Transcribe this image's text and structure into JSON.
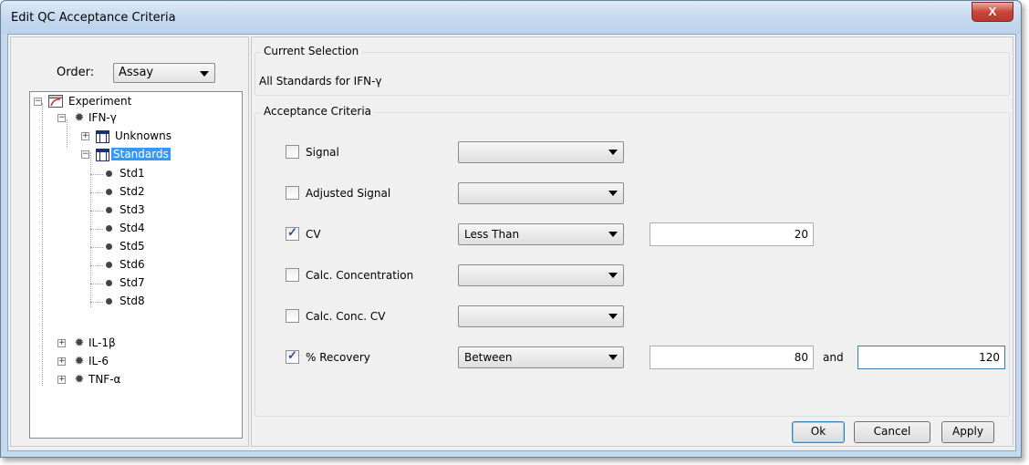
{
  "window": {
    "title": "Edit QC Acceptance Criteria",
    "close_glyph": "X"
  },
  "order": {
    "label": "Order:",
    "value": "Assay"
  },
  "tree": {
    "root": "Experiment",
    "assay1": "IFN-γ",
    "unknowns": "Unknowns",
    "standards": "Standards",
    "stds": [
      "Std1",
      "Std2",
      "Std3",
      "Std4",
      "Std5",
      "Std6",
      "Std7",
      "Std8"
    ],
    "assay2": "IL-1β",
    "assay3": "IL-6",
    "assay4": "TNF-α"
  },
  "current_selection": {
    "group_label": "Current Selection",
    "text": "All Standards for IFN-γ"
  },
  "acceptance": {
    "group_label": "Acceptance Criteria",
    "rows": [
      {
        "label": "Signal",
        "checked": false,
        "operator": "",
        "value1": "",
        "and_label": "",
        "value2": ""
      },
      {
        "label": "Adjusted Signal",
        "checked": false,
        "operator": "",
        "value1": "",
        "and_label": "",
        "value2": ""
      },
      {
        "label": "CV",
        "checked": true,
        "operator": "Less Than",
        "value1": "20",
        "and_label": "",
        "value2": ""
      },
      {
        "label": "Calc. Concentration",
        "checked": false,
        "operator": "",
        "value1": "",
        "and_label": "",
        "value2": ""
      },
      {
        "label": "Calc. Conc. CV",
        "checked": false,
        "operator": "",
        "value1": "",
        "and_label": "",
        "value2": ""
      },
      {
        "label": "% Recovery",
        "checked": true,
        "operator": "Between",
        "value1": "80",
        "and_label": "and",
        "value2": "120"
      }
    ]
  },
  "buttons": {
    "ok": "Ok",
    "cancel": "Cancel",
    "apply": "Apply"
  },
  "colors": {
    "selection": "#3399ff",
    "check_mark": "#2a4f96",
    "close_button": "#c9473a"
  }
}
